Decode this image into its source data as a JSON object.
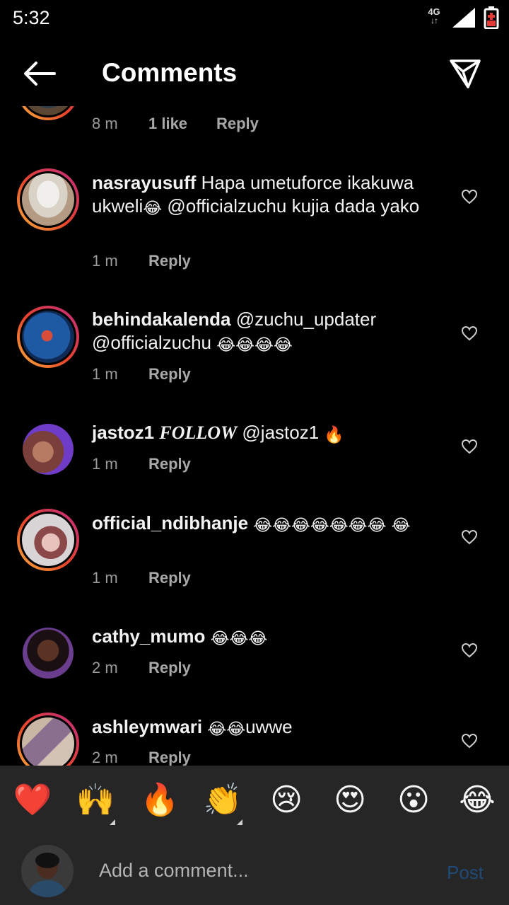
{
  "status": {
    "time": "5:32",
    "network": "4G",
    "network_arrows": "↓↑"
  },
  "header": {
    "title": "Comments"
  },
  "partial_comment": {
    "time": "8 m",
    "likes": "1 like",
    "reply": "Reply"
  },
  "comments": [
    {
      "user": "nasrayusuff",
      "parts": [
        " Hapa umetuforce ikakuwa ukweli",
        "😂",
        " @officialzuchu kujia dada yako"
      ],
      "time": "1 m",
      "reply": "Reply"
    },
    {
      "user": "behindakalenda",
      "parts": [
        " @zuchu_updater @officialzuchu ",
        "😂😂😂😂"
      ],
      "time": "1 m",
      "reply": "Reply"
    },
    {
      "user": "jastoz1",
      "parts": [
        " ",
        "FOLLOW",
        " @jastoz1 ",
        "🔥"
      ],
      "time": "1 m",
      "reply": "Reply"
    },
    {
      "user": "official_ndibhanje",
      "parts": [
        " ",
        "😂😂😂😂😂😂😂",
        " ",
        "😂"
      ],
      "time": "1 m",
      "reply": "Reply"
    },
    {
      "user": "cathy_mumo",
      "parts": [
        " ",
        "😂😂😂"
      ],
      "time": "2 m",
      "reply": "Reply"
    },
    {
      "user": "ashleymwari",
      "parts": [
        " ",
        "😂😂",
        "uwwe"
      ],
      "time": "2 m",
      "reply": "Reply"
    }
  ],
  "reactions": [
    "❤️",
    "🙌",
    "🔥",
    "👏",
    "😢",
    "😍",
    "😮",
    "😂"
  ],
  "composer": {
    "placeholder": "Add a comment...",
    "post_label": "Post"
  },
  "icons": [
    "arrow-left-icon",
    "paper-plane-icon",
    "heart-outline-icon",
    "signal-icon",
    "battery-icon"
  ],
  "colors": {
    "background": "#000000",
    "panel": "#262626",
    "post_disabled": "#1f4a78",
    "muted_text": "#9a9a9a"
  }
}
